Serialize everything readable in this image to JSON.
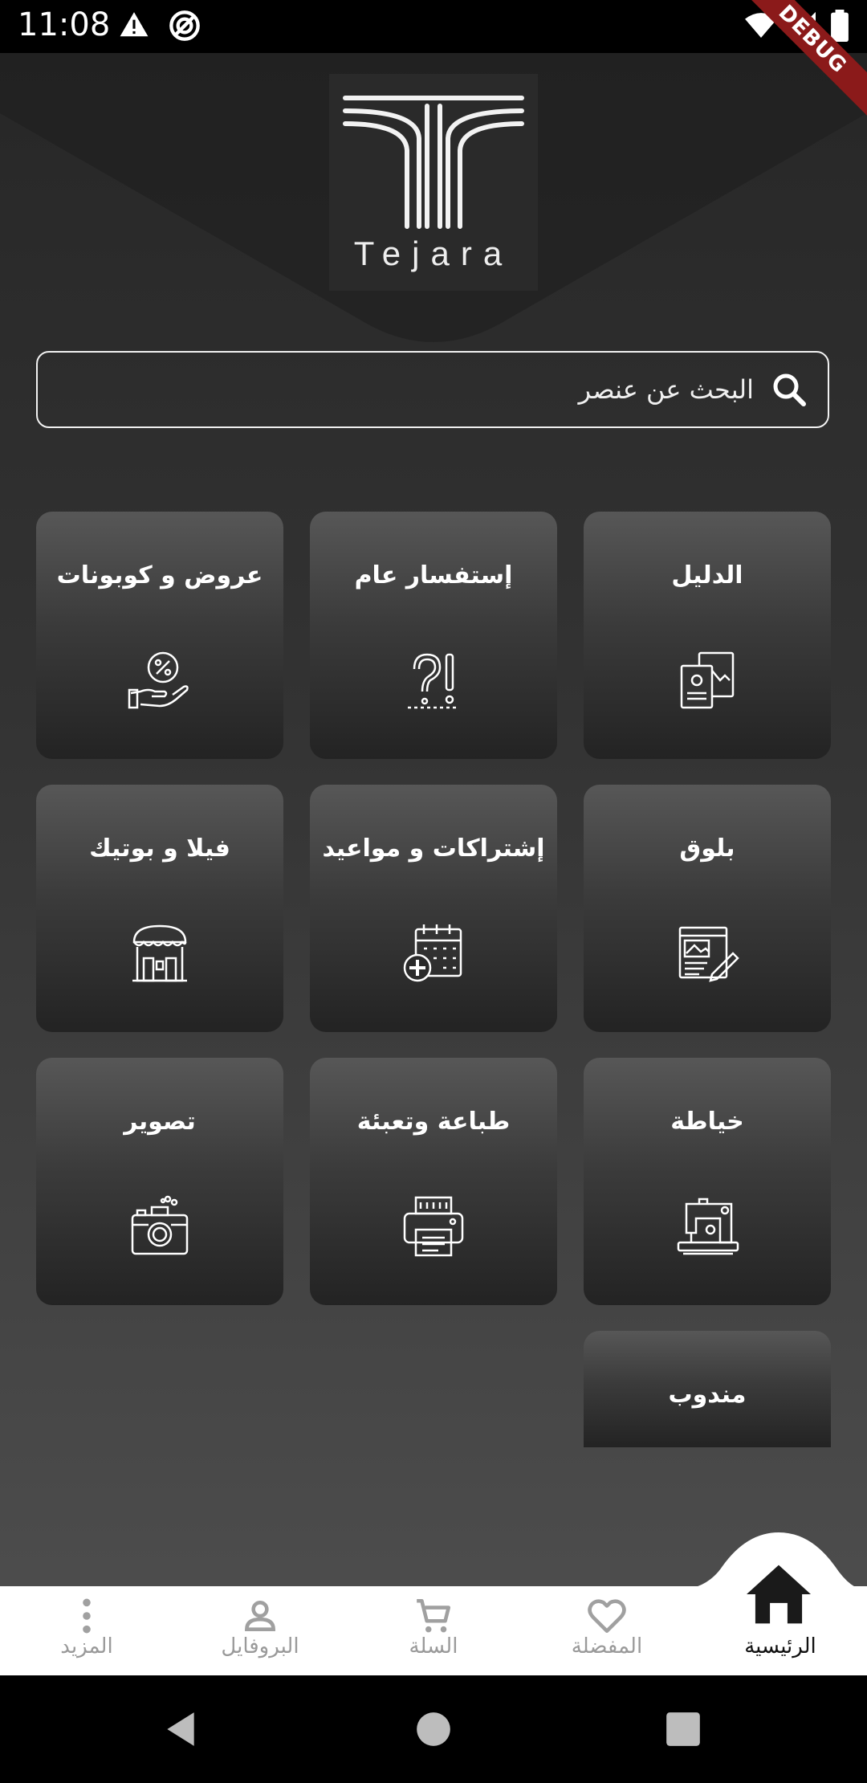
{
  "status_bar": {
    "time": "11:08",
    "debug_label": "DEBUG",
    "icons": [
      "warning-icon",
      "sync-icon",
      "wifi-icon",
      "signal-icon",
      "battery-icon"
    ]
  },
  "logo": {
    "text": "Tejara"
  },
  "search": {
    "placeholder": "البحث عن عنصر"
  },
  "categories": [
    {
      "label": "الدليل",
      "icon": "directory-icon"
    },
    {
      "label": "إستفسار عام",
      "icon": "question-icon"
    },
    {
      "label": "عروض و كوبونات",
      "icon": "discount-hand-icon"
    },
    {
      "label": "بلوق",
      "icon": "blog-icon"
    },
    {
      "label": "إشتراكات و مواعيد",
      "icon": "calendar-add-icon"
    },
    {
      "label": "فيلا و بوتيك",
      "icon": "shop-icon"
    },
    {
      "label": "خياطة",
      "icon": "sewing-machine-icon"
    },
    {
      "label": "طباعة وتعبئة",
      "icon": "printer-icon"
    },
    {
      "label": "تصوير",
      "icon": "camera-icon"
    },
    {
      "label": "مندوب",
      "icon": ""
    }
  ],
  "bottom_nav": [
    {
      "label": "الرئيسية",
      "icon": "home-icon",
      "active": true
    },
    {
      "label": "المفضلة",
      "icon": "heart-icon"
    },
    {
      "label": "السلة",
      "icon": "cart-icon"
    },
    {
      "label": "البروفايل",
      "icon": "profile-icon"
    },
    {
      "label": "المزيد",
      "icon": "more-icon"
    }
  ],
  "colors": {
    "accent": "#ffffff",
    "background": "#333333",
    "nav_active": "#111111",
    "nav_inactive": "#9a9a9a"
  }
}
